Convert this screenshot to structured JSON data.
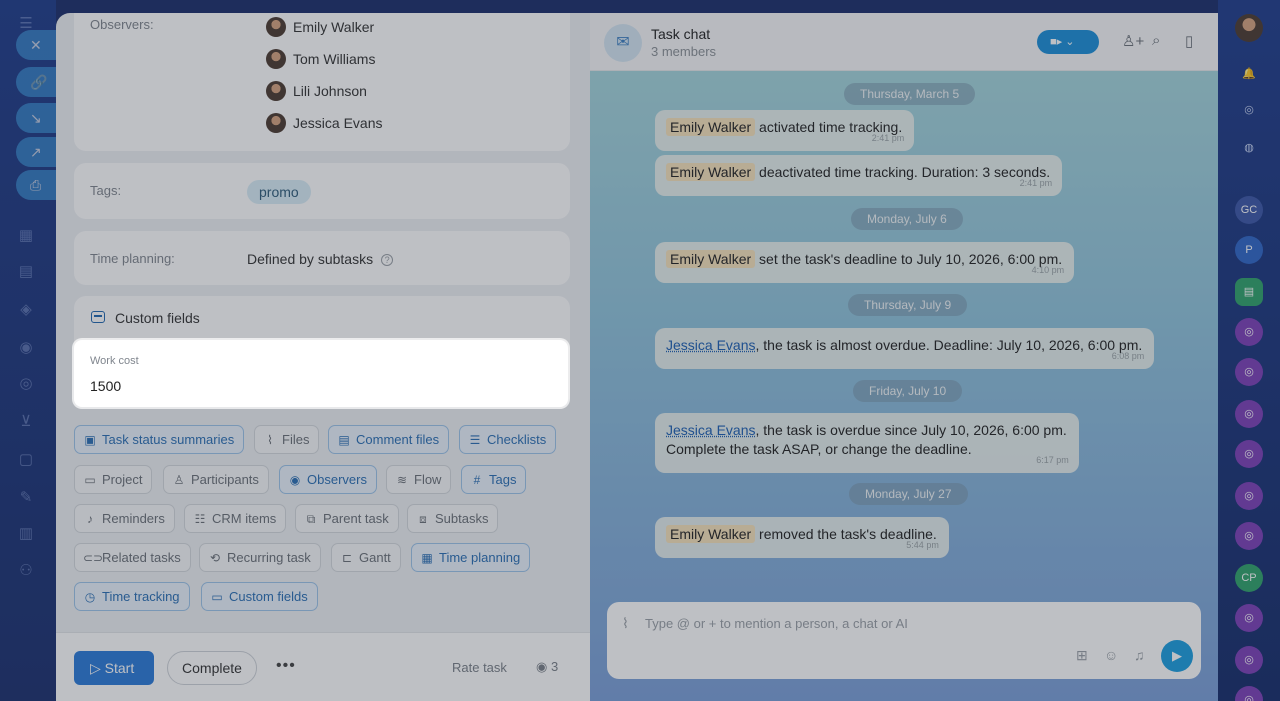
{
  "left_rail": {
    "icons": [
      "menu-icon",
      "close-icon",
      "link-icon",
      "download-icon",
      "external-link-icon",
      "printer-icon",
      "calendar-icon",
      "store-icon",
      "box-icon",
      "shield-icon",
      "target-icon",
      "cart-icon",
      "document-icon",
      "pen-icon",
      "chart-icon",
      "users-icon"
    ]
  },
  "task": {
    "observers_label": "Observers:",
    "observers": [
      "Emily Walker",
      "Tom Williams",
      "Lili Johnson",
      "Jessica Evans"
    ],
    "tags_label": "Tags:",
    "tag": "promo",
    "time_planning_label": "Time planning:",
    "time_planning_value": "Defined by subtasks",
    "help_glyph": "?",
    "custom_fields_title": "Custom fields",
    "work_cost_label": "Work cost",
    "work_cost_value": "1500",
    "chips": {
      "task_status_summaries": "Task status summaries",
      "files": "Files",
      "comment_files": "Comment files",
      "checklists": "Checklists",
      "project": "Project",
      "participants": "Participants",
      "observers": "Observers",
      "flow": "Flow",
      "tags": "Tags",
      "reminders": "Reminders",
      "crm_items": "CRM items",
      "parent_task": "Parent task",
      "subtasks": "Subtasks",
      "related_tasks": "Related tasks",
      "recurring_task": "Recurring task",
      "gantt": "Gantt",
      "time_planning": "Time planning",
      "time_tracking": "Time tracking",
      "custom_fields": "Custom fields"
    },
    "footer": {
      "start": "Start",
      "complete": "Complete",
      "more": "•••",
      "rate": "Rate task",
      "views": "3"
    }
  },
  "chat": {
    "title": "Task chat",
    "members": "3 members",
    "placeholder": "Type @ or + to mention a person, a chat or AI",
    "dates": [
      "Thursday, March 5",
      "Monday, July 6",
      "Thursday, July 9",
      "Friday, July 10",
      "Monday, July 27"
    ],
    "messages": [
      {
        "name": "Emily Walker",
        "text": "activated time tracking.",
        "time": "2:41 pm"
      },
      {
        "name": "Emily Walker",
        "text": "deactivated time tracking. Duration: 3 seconds.",
        "time": "2:41 pm"
      },
      {
        "name": "Emily Walker",
        "text": "set the task's deadline to July 10, 2026, 6:00 pm.",
        "time": "4:10 pm"
      },
      {
        "name": "Jessica Evans",
        "text": ", the task is almost overdue. Deadline: July 10, 2026, 6:00 pm.",
        "time": "6:08 pm"
      },
      {
        "name": "Jessica Evans",
        "text": ", the task is overdue since July 10, 2026, 6:00 pm.",
        "text2": "Complete the task ASAP, or change the deadline.",
        "time": "6:17 pm"
      },
      {
        "name": "Emily Walker",
        "text": "removed the task's deadline.",
        "time": "5:44 pm"
      }
    ]
  },
  "right_rail": {
    "badges": [
      "GC",
      "P",
      "CP"
    ]
  },
  "colors": {
    "accent": "#2a7ad8",
    "chip_active": "#2a6fb5",
    "name_highlight": "#f6e2bb",
    "send": "#1b9ee0"
  }
}
